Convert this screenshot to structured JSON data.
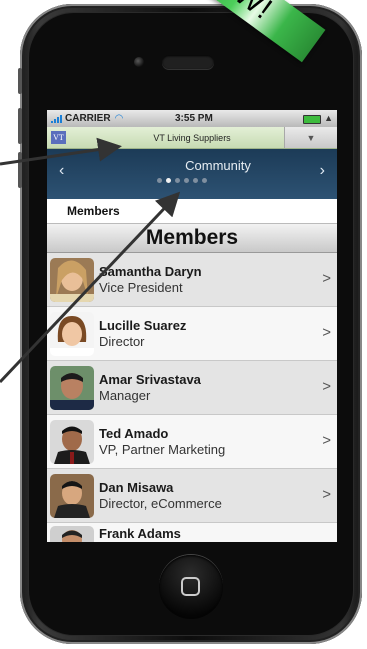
{
  "banner": {
    "text": "W!"
  },
  "status_bar": {
    "carrier": "CARRIER",
    "time": "3:55 PM"
  },
  "app_header": {
    "logo": "VT",
    "title": "VT Living Suppliers",
    "dropdown_icon": "triangle-down"
  },
  "nav": {
    "title": "Community",
    "left_icon": "chevron-left",
    "right_icon": "chevron-right",
    "page_count": 6,
    "current_page": 2
  },
  "breadcrumb": "Members",
  "section_title": "Members",
  "members": [
    {
      "name": "Samantha Daryn",
      "title": "Vice President"
    },
    {
      "name": "Lucille Suarez",
      "title": "Director"
    },
    {
      "name": "Amar Srivastava",
      "title": "Manager"
    },
    {
      "name": "Ted Amado",
      "title": "VP, Partner Marketing"
    },
    {
      "name": "Dan Misawa",
      "title": "Director, eCommerce"
    },
    {
      "name": "Frank Adams",
      "title": ""
    }
  ],
  "colors": {
    "nav_bg": "#24486a",
    "header_bg": "#d3e4c2",
    "banner": "#3bb64a",
    "accent_blue": "#1a7fd6"
  }
}
